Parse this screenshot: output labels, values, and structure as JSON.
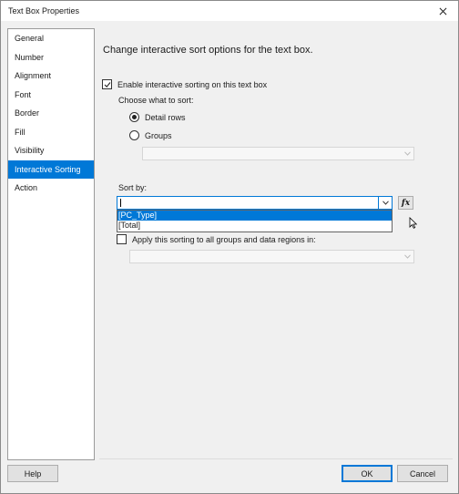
{
  "window": {
    "title": "Text Box Properties"
  },
  "sidebar": {
    "items": [
      {
        "label": "General"
      },
      {
        "label": "Number"
      },
      {
        "label": "Alignment"
      },
      {
        "label": "Font"
      },
      {
        "label": "Border"
      },
      {
        "label": "Fill"
      },
      {
        "label": "Visibility"
      },
      {
        "label": "Interactive Sorting",
        "active": true
      },
      {
        "label": "Action"
      }
    ]
  },
  "main": {
    "heading": "Change interactive sort options for the text box.",
    "enable_checkbox": {
      "label": "Enable interactive sorting on this text box",
      "checked": true
    },
    "choose_label": "Choose what to sort:",
    "radio_detail": {
      "label": "Detail rows",
      "selected": true
    },
    "radio_groups": {
      "label": "Groups",
      "selected": false
    },
    "groups_select": {
      "value": ""
    },
    "sort_by_label": "Sort by:",
    "sort_by_select": {
      "value": ""
    },
    "sort_by_options": [
      "[PC_Type]",
      "[Total]"
    ],
    "fx_label": "fx",
    "apply_checkbox": {
      "label": "Apply this sorting to all groups and data regions in:",
      "checked": false
    },
    "apply_select": {
      "value": ""
    }
  },
  "footer": {
    "help": "Help",
    "ok": "OK",
    "cancel": "Cancel"
  },
  "colors": {
    "accent": "#0078d7",
    "panel": "#f0f0f0"
  }
}
